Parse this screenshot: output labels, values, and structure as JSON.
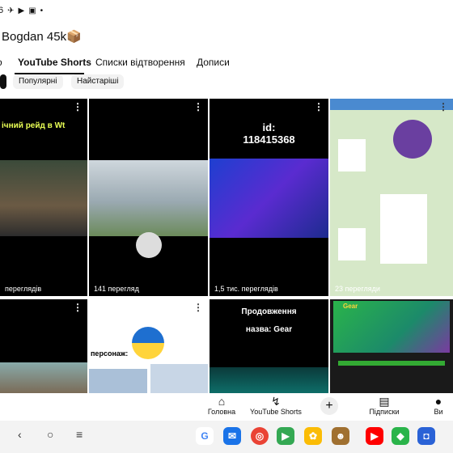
{
  "status_bar": {
    "time": "6",
    "icons": [
      "telegram-icon",
      "play-icon",
      "youtube-icon",
      "dot"
    ]
  },
  "channel": {
    "title": "Bogdan 45k📦"
  },
  "tabs": [
    {
      "label": "о"
    },
    {
      "label": "YouTube Shorts"
    },
    {
      "label": "Списки відтворення"
    },
    {
      "label": "Дописи"
    }
  ],
  "chips": [
    {
      "label": "Популярні"
    },
    {
      "label": "Найстаріші"
    }
  ],
  "shorts": [
    {
      "overlay": "ічний рейд в Wt",
      "views": "переглядів"
    },
    {
      "overlay": "",
      "views": "141 перегляд"
    },
    {
      "overlay": "id:\n118415368",
      "views": "1,5 тис. переглядів"
    },
    {
      "overlay": "",
      "views": "23 перегляди"
    },
    {
      "overlay": "",
      "views": ""
    },
    {
      "overlay": "персонаж:",
      "views": ""
    },
    {
      "overlay": "Продовження\n\nназва: Gear",
      "views": ""
    },
    {
      "overlay": "Gear",
      "views": ""
    }
  ],
  "bottom_nav": {
    "home": "Головна",
    "shorts": "YouTube Shorts",
    "subscriptions": "Підписки",
    "you": "Ви"
  },
  "system_nav": {
    "back": "‹",
    "home": "○",
    "recents": "≡"
  },
  "dock_apps": [
    "G",
    "chat",
    "chrome",
    "play",
    "photos",
    "game",
    "youtube",
    "geometry-dash",
    "roblox"
  ]
}
